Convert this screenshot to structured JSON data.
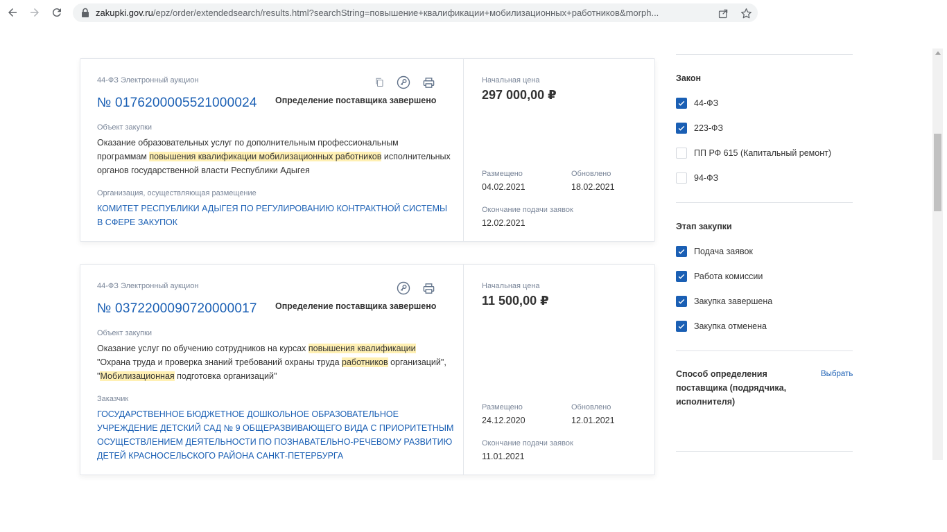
{
  "browser": {
    "url_host": "zakupki.gov.ru",
    "url_rest": "/epz/order/extendedsearch/results.html?searchString=повышение+квалификации+мобилизационных+работников&morph..."
  },
  "cards": [
    {
      "type": "44-ФЗ Электронный аукцион",
      "number": "№ 0176200005521000024",
      "status": "Определение поставщика завершено",
      "object_label": "Объект закупки",
      "object_parts": [
        {
          "t": "Оказание образовательных услуг по дополнительным профессиональным программам ",
          "hl": false
        },
        {
          "t": "повышения квалификации мобилизационных работников",
          "hl": true
        },
        {
          "t": " исполнительных органов государственной власти Республики Адыгея",
          "hl": false
        }
      ],
      "org_label": "Организация, осуществляющая размещение",
      "org": "КОМИТЕТ РЕСПУБЛИКИ АДЫГЕЯ ПО РЕГУЛИРОВАНИЮ КОНТРАКТНОЙ СИСТЕМЫ В СФЕРЕ ЗАКУПОК",
      "price_label": "Начальная цена",
      "price": "297 000,00 ₽",
      "placed_label": "Размещено",
      "placed": "04.02.2021",
      "updated_label": "Обновлено",
      "updated": "18.02.2021",
      "deadline_label": "Окончание подачи заявок",
      "deadline": "12.02.2021",
      "icons": [
        "copy-icon",
        "key-icon",
        "print-icon"
      ]
    },
    {
      "type": "44-ФЗ Электронный аукцион",
      "number": "№ 0372200090720000017",
      "status": "Определение поставщика завершено",
      "object_label": "Объект закупки",
      "object_parts": [
        {
          "t": "Оказание услуг по обучению сотрудников на курсах ",
          "hl": false
        },
        {
          "t": "повышения квалификации",
          "hl": true
        },
        {
          "t": " \"Охрана труда и проверка знаний требований охраны труда ",
          "hl": false
        },
        {
          "t": "работников",
          "hl": true
        },
        {
          "t": " организаций\", \"",
          "hl": false
        },
        {
          "t": "Мобилизационная",
          "hl": true
        },
        {
          "t": " подготовка организаций\"",
          "hl": false
        }
      ],
      "org_label": "Заказчик",
      "org": "ГОСУДАРСТВЕННОЕ БЮДЖЕТНОЕ ДОШКОЛЬНОЕ ОБРАЗОВАТЕЛЬНОЕ УЧРЕЖДЕНИЕ ДЕТСКИЙ САД № 9 ОБЩЕРАЗВИВАЮЩЕГО ВИДА С ПРИОРИТЕТНЫМ ОСУЩЕСТВЛЕНИЕМ ДЕЯТЕЛЬНОСТИ ПО ПОЗНАВАТЕЛЬНО-РЕЧЕВОМУ РАЗВИТИЮ ДЕТЕЙ КРАСНОСЕЛЬСКОГО РАЙОНА САНКТ-ПЕТЕРБУРГА",
      "price_label": "Начальная цена",
      "price": "11 500,00 ₽",
      "placed_label": "Размещено",
      "placed": "24.12.2020",
      "updated_label": "Обновлено",
      "updated": "12.01.2021",
      "deadline_label": "Окончание подачи заявок",
      "deadline": "11.01.2021",
      "icons": [
        "key-icon",
        "print-icon"
      ]
    }
  ],
  "filters": {
    "law_title": "Закон",
    "law_items": [
      {
        "label": "44-ФЗ",
        "checked": true
      },
      {
        "label": "223-ФЗ",
        "checked": true
      },
      {
        "label": "ПП РФ 615 (Капитальный ремонт)",
        "checked": false
      },
      {
        "label": "94-ФЗ",
        "checked": false
      }
    ],
    "stage_title": "Этап закупки",
    "stage_items": [
      {
        "label": "Подача заявок",
        "checked": true
      },
      {
        "label": "Работа комиссии",
        "checked": true
      },
      {
        "label": "Закупка завершена",
        "checked": true
      },
      {
        "label": "Закупка отменена",
        "checked": true
      }
    ],
    "method_title": "Способ определения поставщика (подрядчика, исполнителя)",
    "method_link": "Выбрать"
  },
  "colors": {
    "accent": "#1a5fb4",
    "highlight": "#fff0b3"
  }
}
